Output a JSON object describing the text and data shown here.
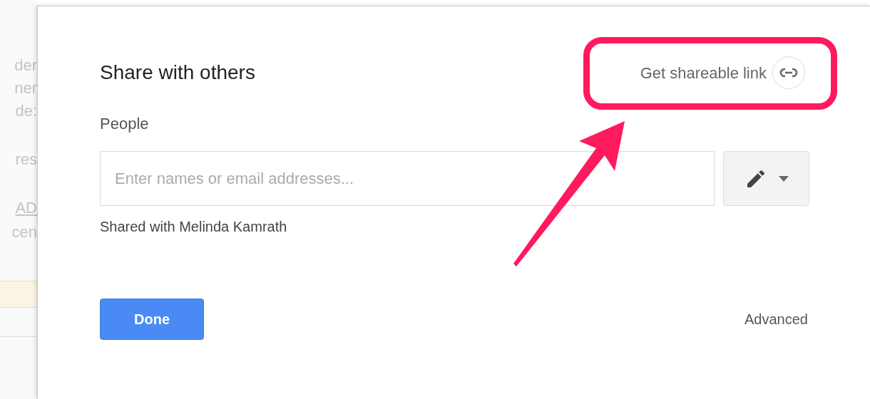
{
  "background_page": {
    "lines": [
      {
        "text": "der",
        "kind": "text"
      },
      {
        "text": "ner",
        "kind": "text"
      },
      {
        "text": "de:",
        "kind": "text"
      },
      {
        "text": "res",
        "kind": "text"
      },
      {
        "text": "AD",
        "kind": "link"
      },
      {
        "text": "cen",
        "kind": "text"
      }
    ]
  },
  "dialog": {
    "title": "Share with others",
    "shareable_link": "Get shareable link",
    "people_label": "People",
    "people_field": {
      "placeholder": "Enter names or email addresses..."
    },
    "shared_with": "Shared with Melinda Kamrath",
    "done_button": "Done",
    "advanced_link": "Advanced"
  }
}
